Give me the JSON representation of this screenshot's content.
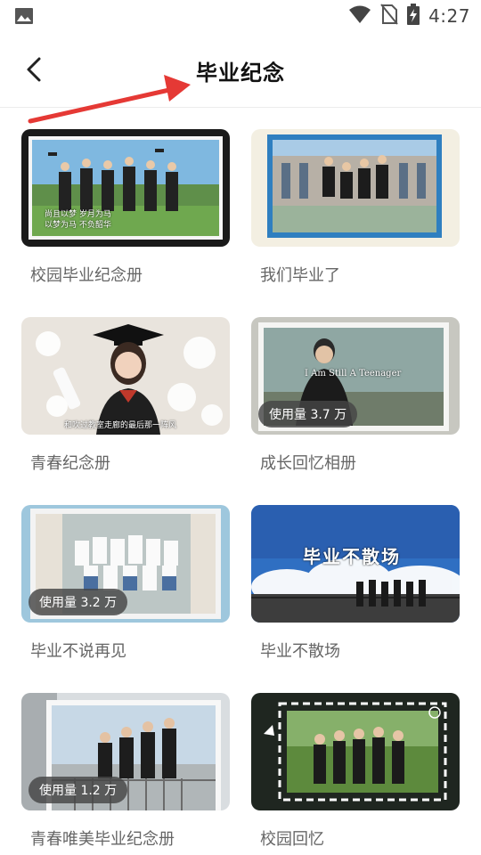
{
  "status_bar": {
    "time": "4:27",
    "icons": [
      "image-icon",
      "wifi-icon",
      "no-sim-icon",
      "battery-charging-icon"
    ]
  },
  "header": {
    "title": "毕业纪念",
    "back_icon": "back-arrow-icon"
  },
  "templates": [
    {
      "title": "校园毕业纪念册",
      "usage": "",
      "inner_text": "尚且以梦 岁月为马\n以梦为马 不负韶华"
    },
    {
      "title": "我们毕业了",
      "usage": "",
      "inner_text": ""
    },
    {
      "title": "青春纪念册",
      "usage": "",
      "inner_text": "和吹过教室走廊的最后那一阵风"
    },
    {
      "title": "成长回忆相册",
      "usage": "使用量 3.7 万",
      "inner_text": "I Am Still A Teenager"
    },
    {
      "title": "毕业不说再见",
      "usage": "使用量 3.2 万",
      "inner_text": ""
    },
    {
      "title": "毕业不散场",
      "usage": "",
      "inner_text": "毕业不散场"
    },
    {
      "title": "青春唯美毕业纪念册",
      "usage": "使用量 1.2 万",
      "inner_text": ""
    },
    {
      "title": "校园回忆",
      "usage": "",
      "inner_text": ""
    }
  ],
  "annotation": {
    "arrow_color": "#e53935"
  }
}
